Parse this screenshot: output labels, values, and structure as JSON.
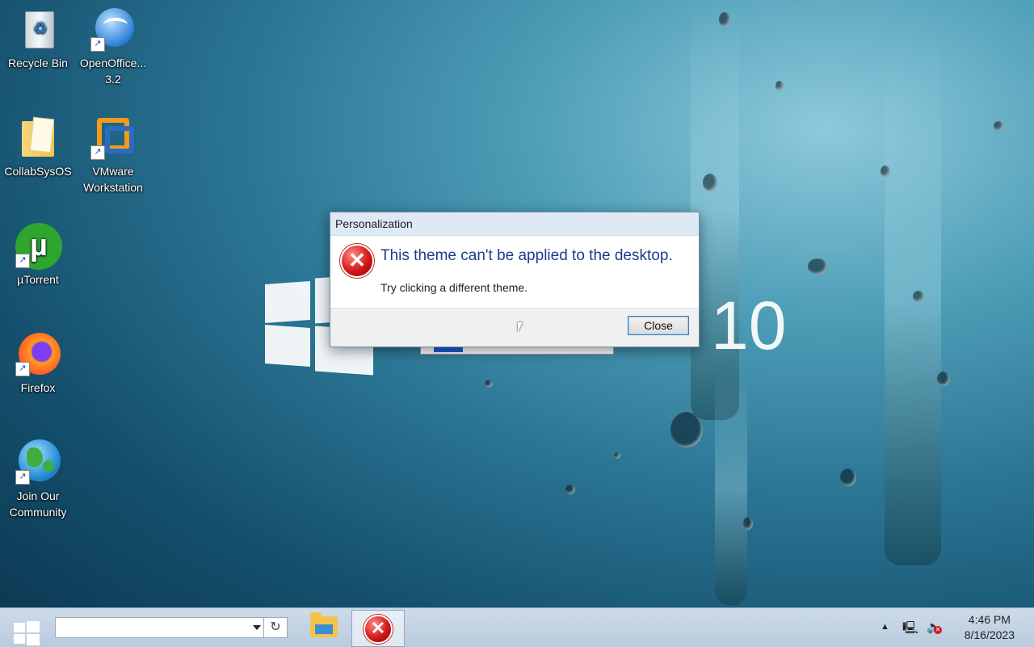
{
  "desktop": {
    "icons": [
      {
        "label": "Recycle Bin",
        "icon": "recycle-bin-icon"
      },
      {
        "label": "OpenOffice...\n3.2",
        "label_line1": "OpenOffice...",
        "label_line2": "3.2",
        "icon": "openoffice-icon"
      },
      {
        "label": "CollabSysOS",
        "icon": "folder-icon"
      },
      {
        "label_line1": "VMware",
        "label_line2": "Workstation",
        "icon": "vmware-icon"
      },
      {
        "label": "µTorrent",
        "icon": "utorrent-icon"
      },
      {
        "label": "Firefox",
        "icon": "firefox-icon"
      },
      {
        "label_line1": "Join Our",
        "label_line2": "Community",
        "icon": "globe-icon"
      }
    ],
    "wallpaper_brand": "10"
  },
  "dialog": {
    "title": "Personalization",
    "main_instruction": "This theme can't be applied to the desktop.",
    "content": "Try clicking a different theme.",
    "close_label": "Close",
    "icon": "error-icon"
  },
  "taskbar": {
    "search_value": "",
    "refresh_glyph": "↻",
    "tray": {
      "show_hidden_glyph": "▲",
      "network_glyph": "🖳",
      "volume_glyph": "🔈"
    },
    "clock": {
      "time": "4:46 PM",
      "date": "8/16/2023"
    }
  },
  "colors": {
    "dialog_instruction": "#1c3c8c",
    "error_red": "#d11a1a",
    "taskbar": "#c6d6e6"
  }
}
